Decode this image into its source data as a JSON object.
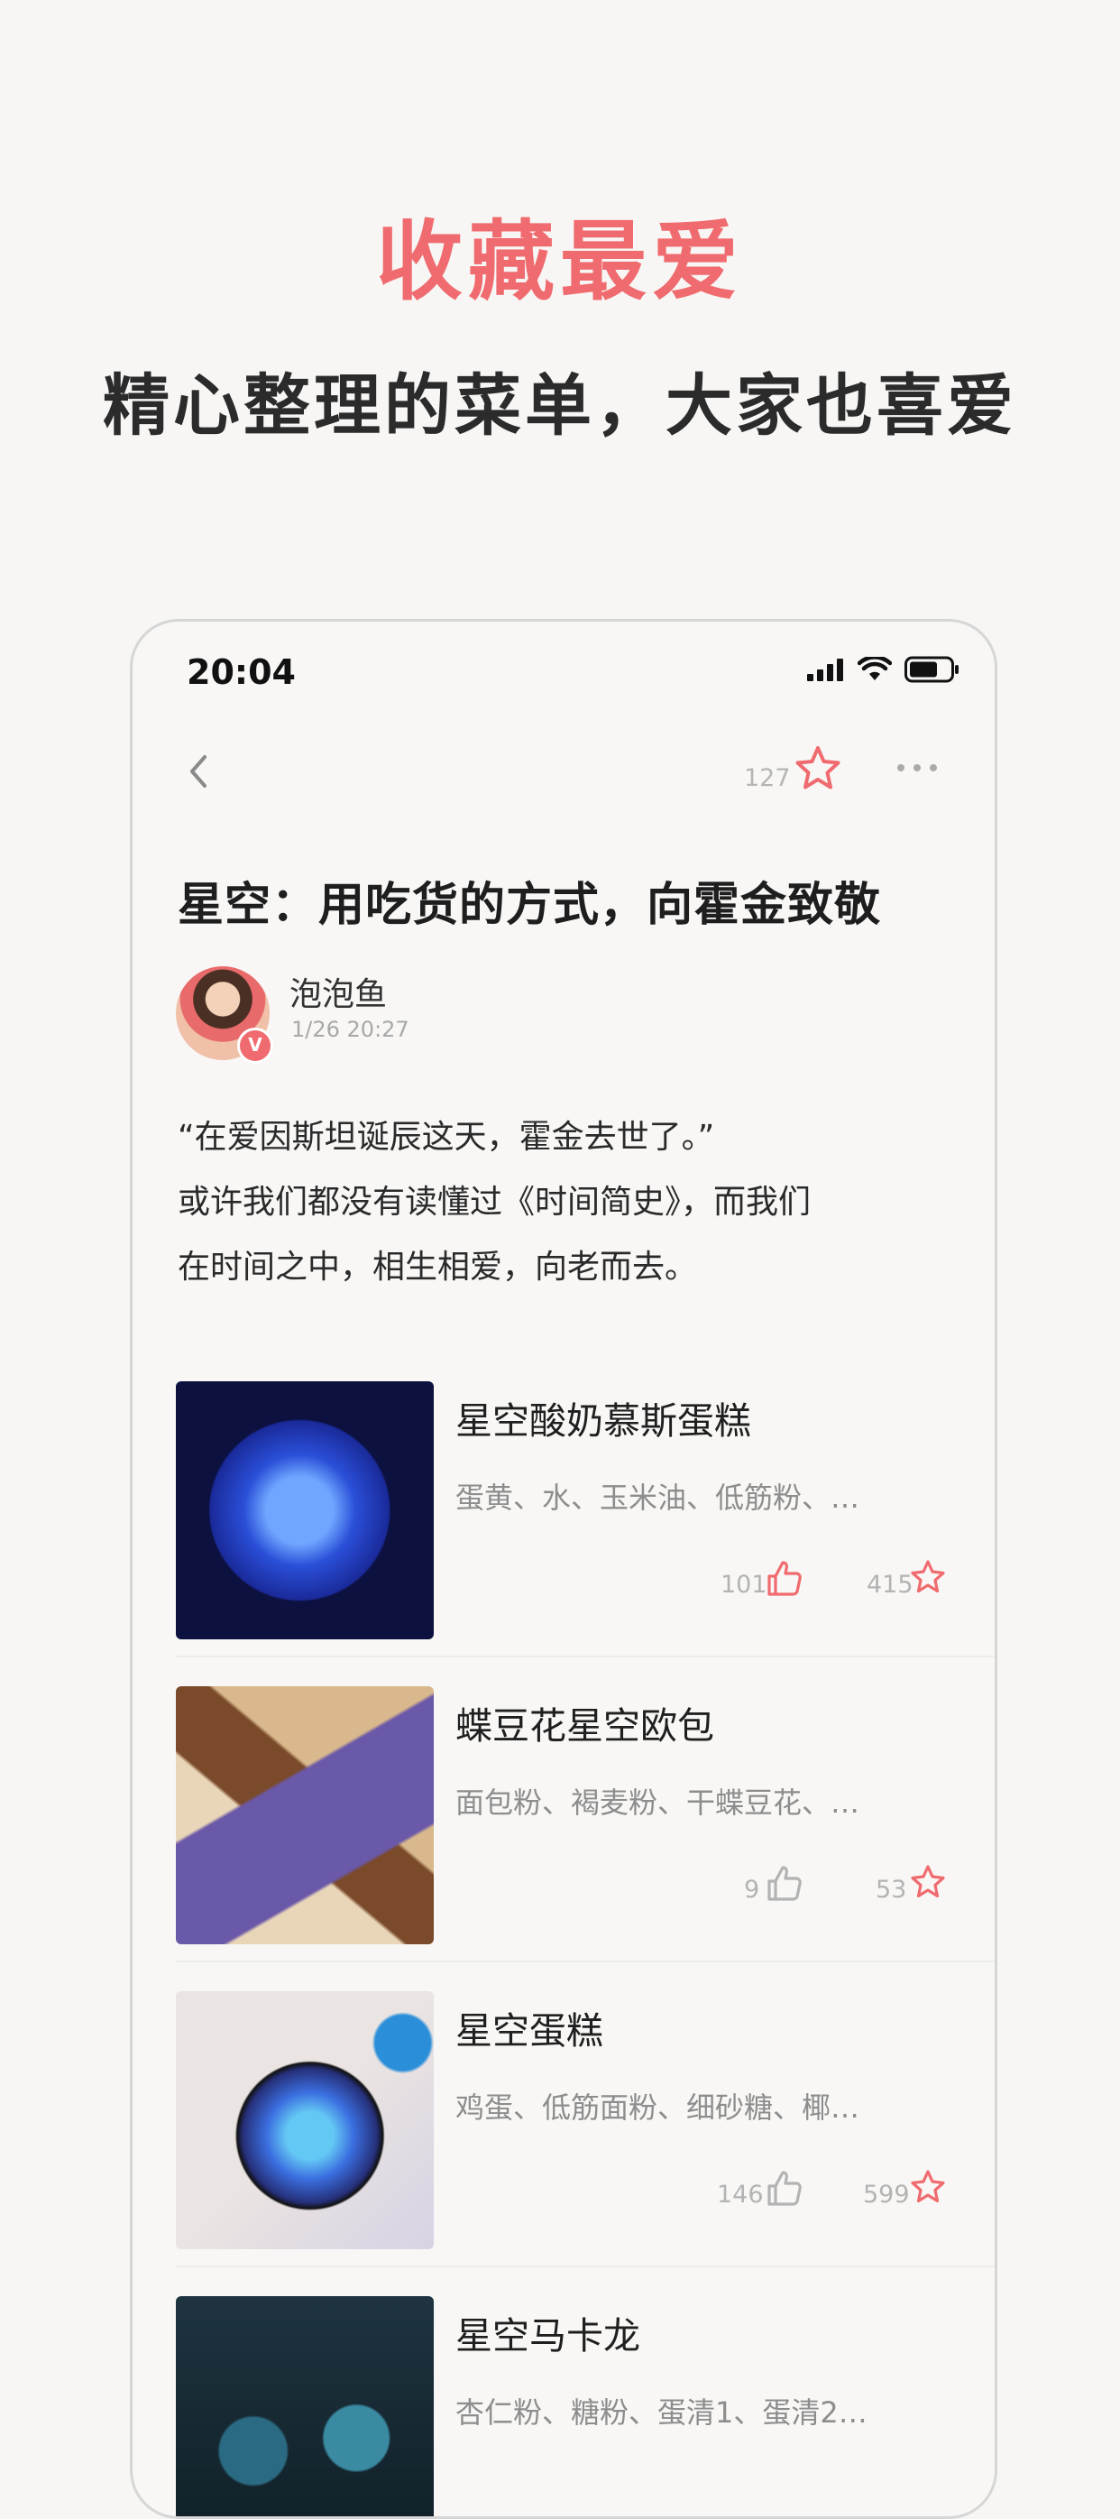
{
  "hero": {
    "title": "收藏最爱",
    "subtitle": "精心整理的菜单，大家也喜爱"
  },
  "status_bar": {
    "time": "20:04",
    "icons": [
      "signal-icon",
      "wifi-icon",
      "battery-icon"
    ]
  },
  "nav": {
    "favorite_count": "127",
    "icons": [
      "back-icon",
      "star-icon",
      "more-icon"
    ]
  },
  "article": {
    "title": "星空：用吃货的方式，向霍金致敬",
    "author_name": "泡泡鱼",
    "author_date": "1/26 20:27",
    "verified_badge": "V",
    "intro_lines": [
      "“在爱因斯坦诞辰这天，霍金去世了。”",
      "或许我们都没有读懂过《时间简史》，而我们",
      "在时间之中，相生相爱，向老而去。"
    ]
  },
  "recipes": [
    {
      "name": "星空酸奶慕斯蛋糕",
      "ingredients": "蛋黄、水、玉米油、低筋粉、…",
      "likes": "101",
      "favorites": "415",
      "liked": true
    },
    {
      "name": "蝶豆花星空欧包",
      "ingredients": "面包粉、褐麦粉、干蝶豆花、…",
      "likes": "9",
      "favorites": "53",
      "liked": false
    },
    {
      "name": "星空蛋糕",
      "ingredients": "鸡蛋、低筋面粉、细砂糖、椰…",
      "likes": "146",
      "favorites": "599",
      "liked": false
    },
    {
      "name": "星空马卡龙",
      "ingredients": "杏仁粉、糖粉、蛋清1、蛋清2…",
      "likes": "",
      "favorites": "",
      "liked": false
    }
  ],
  "colors": {
    "accent": "#f06b6f",
    "text": "#1f1f1f",
    "muted": "#8d8d8d"
  }
}
